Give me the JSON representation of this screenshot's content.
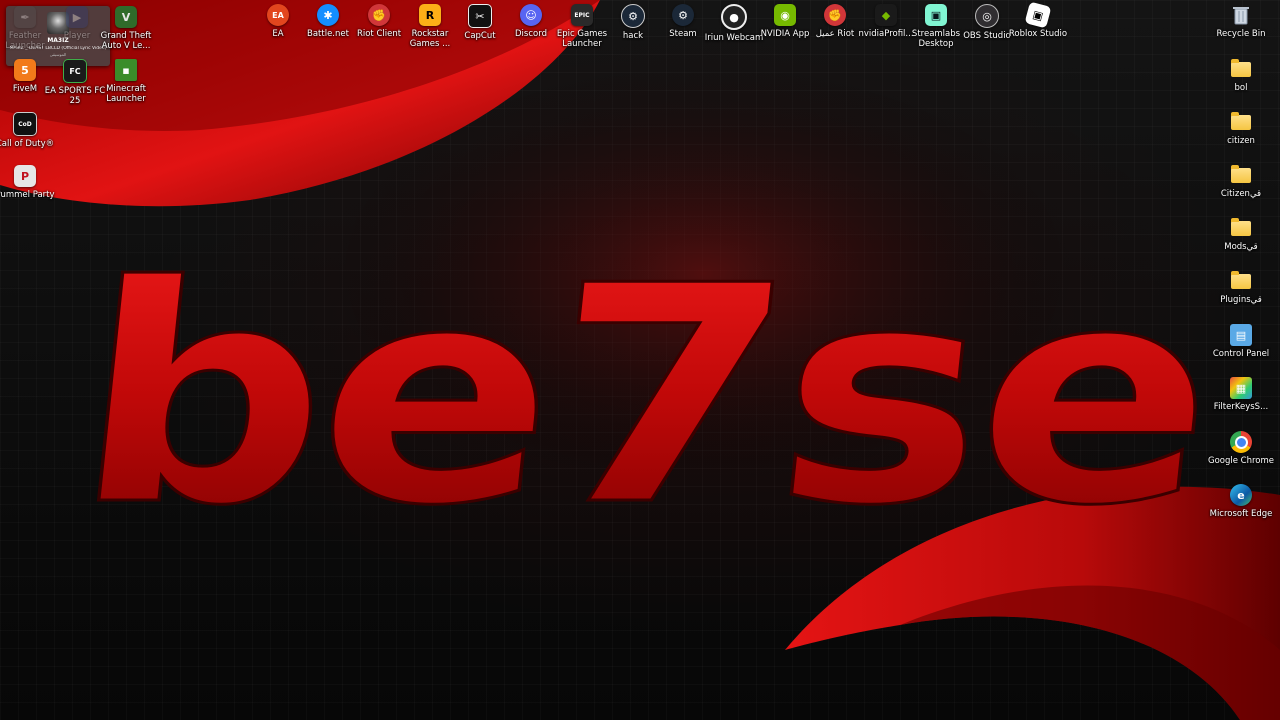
{
  "desktop": {
    "wallpaper_text": "be7se",
    "colors": {
      "accent_red": "#d10a0a",
      "background": "#0b0b0b"
    },
    "media_popup": {
      "artist": "MA3IZ",
      "track": "MA3IZ _ DEAST LBCLD (Official Lyric Video)",
      "sub": "الموسيقى"
    },
    "top_icons": [
      {
        "label": "EA",
        "icon": "ea-icon"
      },
      {
        "label": "Battle.net",
        "icon": "battlenet-icon"
      },
      {
        "label": "Riot Client",
        "icon": "riot-client-icon"
      },
      {
        "label": "Rockstar Games ...",
        "icon": "rockstar-icon"
      },
      {
        "label": "CapCut",
        "icon": "capcut-icon"
      },
      {
        "label": "Discord",
        "icon": "discord-icon"
      },
      {
        "label": "Epic Games Launcher",
        "icon": "epic-games-icon"
      },
      {
        "label": "hack",
        "icon": "hack-icon"
      },
      {
        "label": "Steam",
        "icon": "steam-icon"
      },
      {
        "label": "Iriun Webcam",
        "icon": "iriun-webcam-icon"
      },
      {
        "label": "NVIDIA App",
        "icon": "nvidia-app-icon"
      },
      {
        "label": "عميل Riot",
        "icon": "riot-arabic-icon"
      },
      {
        "label": "nvidiaProfil...",
        "icon": "nvidia-profile-icon"
      },
      {
        "label": "Streamlabs Desktop",
        "icon": "streamlabs-icon"
      },
      {
        "label": "OBS Studio",
        "icon": "obs-icon"
      },
      {
        "label": "Roblox Studio",
        "icon": "roblox-studio-icon"
      }
    ],
    "left_icons": [
      {
        "label": "Feather Launcher",
        "icon": "feather-icon"
      },
      {
        "label": "Player",
        "icon": "player-icon"
      },
      {
        "label": "Grand Theft Auto V Le...",
        "icon": "gta-icon"
      },
      {
        "label": "FiveM",
        "icon": "fivem-icon"
      },
      {
        "label": "EA SPORTS FC 25",
        "icon": "fc25-icon"
      },
      {
        "label": "Minecraft Launcher",
        "icon": "minecraft-icon"
      },
      {
        "label": "Call of Duty®",
        "icon": "cod-icon"
      },
      {
        "label": "Pummel Party",
        "icon": "pummel-party-icon"
      }
    ],
    "right_icons": [
      {
        "label": "Recycle Bin",
        "icon": "recycle-bin-icon"
      },
      {
        "label": "bol",
        "icon": "folder-icon"
      },
      {
        "label": "citizen",
        "icon": "folder-icon"
      },
      {
        "label": "Citizenقي",
        "icon": "folder-icon"
      },
      {
        "label": "Modsقي",
        "icon": "folder-icon"
      },
      {
        "label": "Pluginsقي",
        "icon": "folder-icon"
      },
      {
        "label": "Control Panel",
        "icon": "control-panel-icon"
      },
      {
        "label": "FilterKeysS...",
        "icon": "filterkeys-icon"
      },
      {
        "label": "Google Chrome",
        "icon": "chrome-icon"
      },
      {
        "label": "Microsoft Edge",
        "icon": "edge-icon"
      }
    ]
  }
}
